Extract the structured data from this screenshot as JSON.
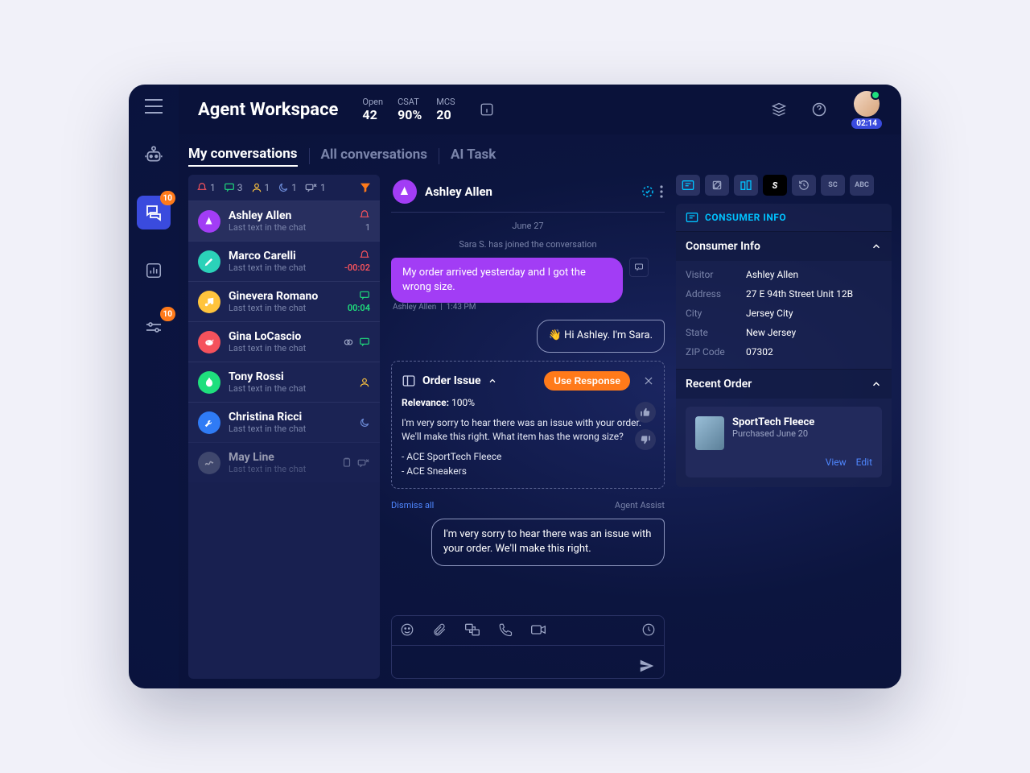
{
  "header": {
    "title": "Agent Workspace",
    "metrics": {
      "open": {
        "label": "Open",
        "value": "42"
      },
      "csat": {
        "label": "CSAT",
        "value": "90%"
      },
      "mcs": {
        "label": "MCS",
        "value": "20"
      }
    },
    "timer": "02:14"
  },
  "sidebar": {
    "badgeChat": "10",
    "badgeSettings": "10"
  },
  "tabs": {
    "my": "My conversations",
    "all": "All conversations",
    "ai": "AI Task"
  },
  "filters": {
    "bell": "1",
    "chat": "3",
    "person": "1",
    "moon": "1",
    "escalate": "1"
  },
  "conversations": [
    {
      "name": "Ashley Allen",
      "sub": "Last text in the chat",
      "right1": "bell",
      "right2": "1",
      "avatarColor": "#A23DF5",
      "avatarIcon": "sail"
    },
    {
      "name": "Marco Carelli",
      "sub": "Last text in the chat",
      "right1": "bell",
      "right2": "-00:02",
      "r2class": "txt-red",
      "avatarColor": "#2BD2B9",
      "avatarIcon": "pen"
    },
    {
      "name": "Ginevera Romano",
      "sub": "Last text in the chat",
      "right1": "chat",
      "right2": "00:04",
      "r2class": "txt-green",
      "avatarColor": "#FFC43D",
      "avatarIcon": "music"
    },
    {
      "name": "Gina LoCascio",
      "sub": "Last text in the chat",
      "right1": "dual",
      "avatarColor": "#F5525C",
      "avatarIcon": "pig"
    },
    {
      "name": "Tony Rossi",
      "sub": "Last text in the chat",
      "right1": "person",
      "avatarColor": "#1FDF7D",
      "avatarIcon": "pear"
    },
    {
      "name": "Christina Ricci",
      "sub": "Last text in the chat",
      "right1": "moon",
      "avatarColor": "#2F7BF5",
      "avatarIcon": "wrench"
    },
    {
      "name": "May Line",
      "sub": "Last text in the chat",
      "right1": "closed",
      "avatarColor": "#5F6786",
      "avatarIcon": "squig",
      "muted": true
    }
  ],
  "chat": {
    "name": "Ashley Allen",
    "date": "June 27",
    "sys": "Sara S. has joined the conversation",
    "msg1": "My order arrived yesterday and I got the wrong size.",
    "msg1_meta_name": "Ashley Allen",
    "msg1_meta_time": "1:43 PM",
    "msg2": "👋 Hi Ashley. I'm Sara.",
    "assist": {
      "title": "Order Issue",
      "use": "Use Response",
      "relevance_label": "Relevance:",
      "relevance_value": "100%",
      "body": "I'm very sorry to hear there was an issue with your order. We'll make this right. What item has the wrong size?",
      "line1": "- ACE SportTech Fleece",
      "line2": "- ACE Sneakers",
      "dismiss": "Dismiss all",
      "assist_label": "Agent Assist"
    },
    "msg3": "I'm very sorry to hear there was an issue with your order. We'll make this right."
  },
  "right": {
    "card_title": "CONSUMER INFO",
    "sec1": "Consumer Info",
    "info": {
      "visitor_k": "Visitor",
      "visitor_v": "Ashley Allen",
      "address_k": "Address",
      "address_v": "27 E 94th Street Unit 12B",
      "city_k": "City",
      "city_v": "Jersey City",
      "state_k": "State",
      "state_v": "New Jersey",
      "zip_k": "ZIP Code",
      "zip_v": "07302"
    },
    "sec2": "Recent Order",
    "order": {
      "title": "SportTech Fleece",
      "sub": "Purchased June 20",
      "view": "View",
      "edit": "Edit"
    },
    "pills": {
      "sc": "SC",
      "abc": "ABC"
    }
  }
}
